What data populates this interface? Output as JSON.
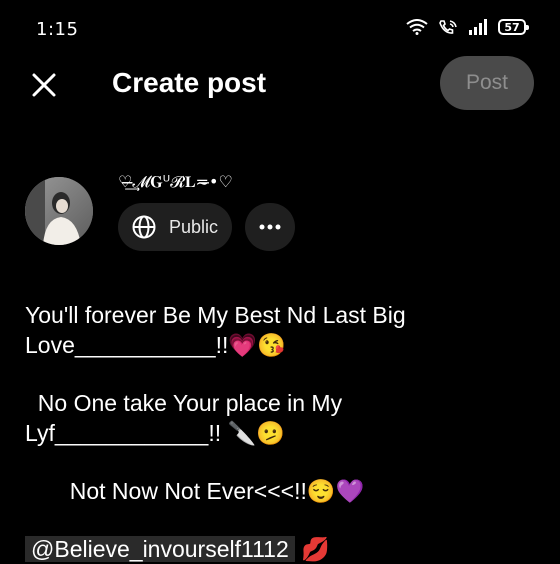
{
  "status_bar": {
    "time": "1:15",
    "battery": "57",
    "icons": [
      "wifi-icon",
      "wifi-calling-icon",
      "signal-icon",
      "battery-icon"
    ]
  },
  "appbar": {
    "title": "Create post",
    "post_label": "Post",
    "close_icon": "close-icon"
  },
  "author": {
    "name": "♡̶̶̶͢͢͢𝓜𝐆ᵁ𝓡𝐋≂̶•♡",
    "audience": "Public",
    "audience_icon": "globe-icon",
    "more_icon": "more-horizontal-icon"
  },
  "post": {
    "line1": "You'll forever Be My Best Nd Last Big",
    "line2": "Love___________!!💗😘",
    "line3": "  No One take Your place in My",
    "line4": "Lyf____________!! 🔪🫤",
    "line5": "       Not Now Not Ever<<<!!😌💜",
    "mention": "@Believe_invourself1112",
    "mention_tail": " 💋"
  },
  "colors": {
    "background": "#000000",
    "post_button_bg": "#4a4a4a",
    "post_button_text": "#8e8e8e",
    "chip_bg": "#1f1f1f"
  }
}
